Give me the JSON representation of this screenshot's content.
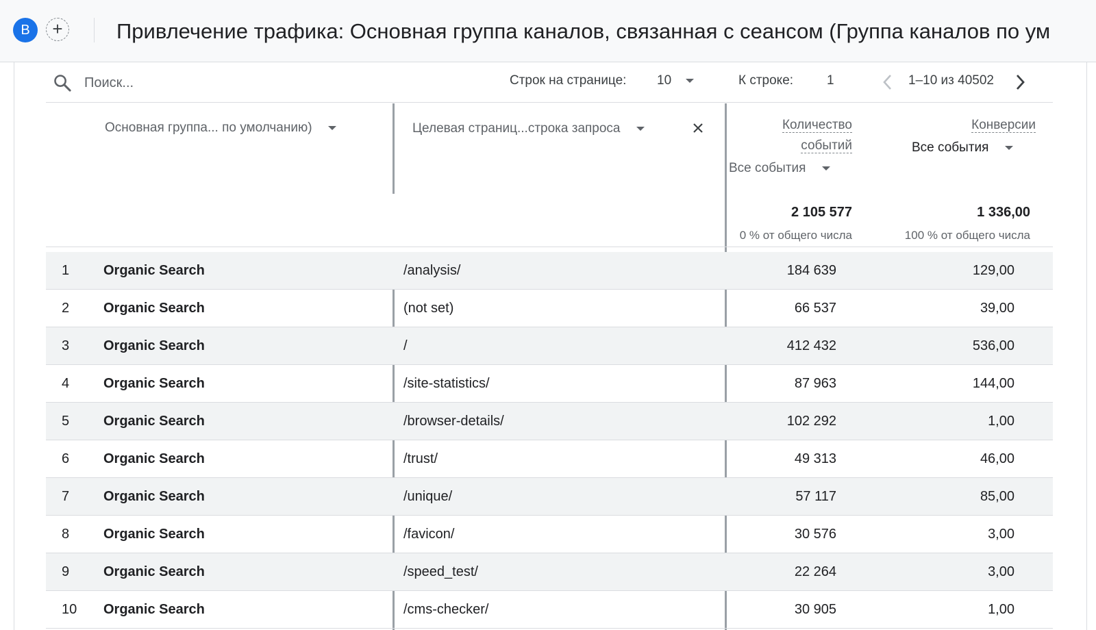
{
  "header": {
    "avatar_letter": "B",
    "add_label": "+",
    "title": "Привлечение трафика: Основная группа каналов, связанная с сеансом (Группа каналов по ум"
  },
  "toolbar": {
    "search_placeholder": "Поиск...",
    "rows_per_page_label": "Строк на странице:",
    "rows_per_page_value": "10",
    "goto_row_label": "К строке:",
    "goto_row_value": "1",
    "pagination_text": "1–10 из 40502"
  },
  "columns": {
    "dimension1": "Основная группа... по умолчанию)",
    "dimension2": "Целевая страниц...строка запроса",
    "metric1_line1": "Количество",
    "metric1_line2": "событий",
    "metric1_filter": "Все события",
    "metric2_name": "Конверсии",
    "metric2_filter": "Все события"
  },
  "totals": {
    "events": "2 105 577",
    "events_pct": "0 % от общего числа",
    "conversions": "1 336,00",
    "conversions_pct": "100 % от общего числа"
  },
  "rows": [
    {
      "index": "1",
      "channel": "Organic Search",
      "page": "/analysis/",
      "events": "184 639",
      "conversions": "129,00"
    },
    {
      "index": "2",
      "channel": "Organic Search",
      "page": "(not set)",
      "events": "66 537",
      "conversions": "39,00"
    },
    {
      "index": "3",
      "channel": "Organic Search",
      "page": "/",
      "events": "412 432",
      "conversions": "536,00"
    },
    {
      "index": "4",
      "channel": "Organic Search",
      "page": "/site-statistics/",
      "events": "87 963",
      "conversions": "144,00"
    },
    {
      "index": "5",
      "channel": "Organic Search",
      "page": "/browser-details/",
      "events": "102 292",
      "conversions": "1,00"
    },
    {
      "index": "6",
      "channel": "Organic Search",
      "page": "/trust/",
      "events": "49 313",
      "conversions": "46,00"
    },
    {
      "index": "7",
      "channel": "Organic Search",
      "page": "/unique/",
      "events": "57 117",
      "conversions": "85,00"
    },
    {
      "index": "8",
      "channel": "Organic Search",
      "page": "/favicon/",
      "events": "30 576",
      "conversions": "3,00"
    },
    {
      "index": "9",
      "channel": "Organic Search",
      "page": "/speed_test/",
      "events": "22 264",
      "conversions": "3,00"
    },
    {
      "index": "10",
      "channel": "Organic Search",
      "page": "/cms-checker/",
      "events": "30 905",
      "conversions": "1,00"
    }
  ]
}
